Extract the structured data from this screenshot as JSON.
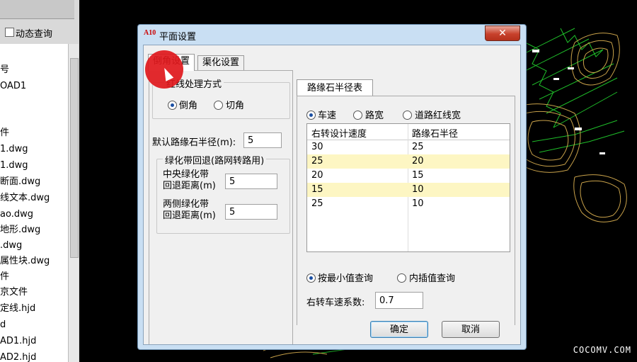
{
  "left_panel": {
    "dynamic_query_label": "动态查询",
    "files": [
      "号",
      "OAD1",
      "",
      "件",
      "1.dwg",
      "1.dwg",
      "断面.dwg",
      "线文本.dwg",
      "ao.dwg",
      "地形.dwg",
      ".dwg",
      "属性块.dwg",
      "件",
      "京文件",
      "定线.hjd",
      "d",
      "AD1.hjd",
      "AD2.hjd"
    ]
  },
  "dialog": {
    "app_icon_text": "A10",
    "title": "平面设置",
    "close_symbol": "✕",
    "tabs": [
      "倒角设置",
      "渠化设置"
    ],
    "corner_group": {
      "title": "红线处理方式",
      "options": [
        "倒角",
        "切角"
      ],
      "selected": 0
    },
    "default_radius": {
      "label": "默认路缘石半径(m):",
      "value": "5"
    },
    "green_group": {
      "title": "绿化带回退(路网转路用)",
      "center": {
        "label_line1": "中央绿化带",
        "label_line2": "回退距离(m)",
        "value": "5"
      },
      "sides": {
        "label_line1": "两侧绿化带",
        "label_line2": "回退距离(m)",
        "value": "5"
      }
    },
    "radius_table": {
      "tab_label": "路缘石半径表",
      "mode_options": [
        "车速",
        "路宽",
        "道路红线宽"
      ],
      "mode_selected": 0,
      "columns": [
        "右转设计速度",
        "路缘石半径"
      ],
      "rows": [
        [
          "30",
          "25"
        ],
        [
          "25",
          "20"
        ],
        [
          "20",
          "15"
        ],
        [
          "15",
          "10"
        ],
        [
          "25",
          "10"
        ]
      ],
      "query_options": [
        "按最小值查询",
        "内插值查询"
      ],
      "query_selected": 0,
      "coef": {
        "label": "右转车速系数:",
        "value": "0.7"
      }
    },
    "ok_label": "确定",
    "cancel_label": "取消"
  },
  "watermark": "COCOMV.COM",
  "colors": {
    "row_highlight": "#fdf6c3",
    "cursor_highlight": "#e0181c"
  }
}
